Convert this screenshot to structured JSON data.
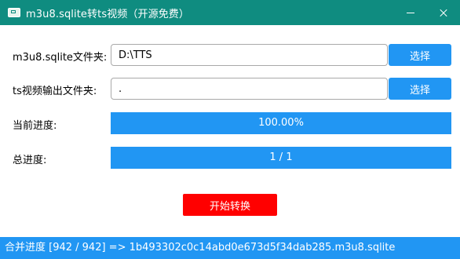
{
  "window": {
    "title": "m3u8.sqlite转ts视频（开源免费）"
  },
  "form": {
    "sqlite_folder": {
      "label": "m3u8.sqlite文件夹:",
      "value": "D:\\TTS",
      "button_label": "选择"
    },
    "output_folder": {
      "label": "ts视频输出文件夹:",
      "value": ".",
      "button_label": "选择"
    }
  },
  "progress": {
    "current": {
      "label": "当前进度:",
      "text": "100.00%",
      "fraction": 1.0
    },
    "total": {
      "label": "总进度:",
      "text": "1 / 1",
      "fraction": 1.0
    }
  },
  "actions": {
    "start_label": "开始转换"
  },
  "status": {
    "text": "合并进度 [942 / 942] => 1b493302c0c14abd0e673d5f34dab285.m3u8.sqlite"
  },
  "colors": {
    "titlebar": "#0f8c80",
    "accent": "#2196f3",
    "start_button": "#ff0000"
  },
  "icons": {
    "app": "app-icon",
    "minimize": "minimize-icon",
    "close": "close-icon"
  }
}
